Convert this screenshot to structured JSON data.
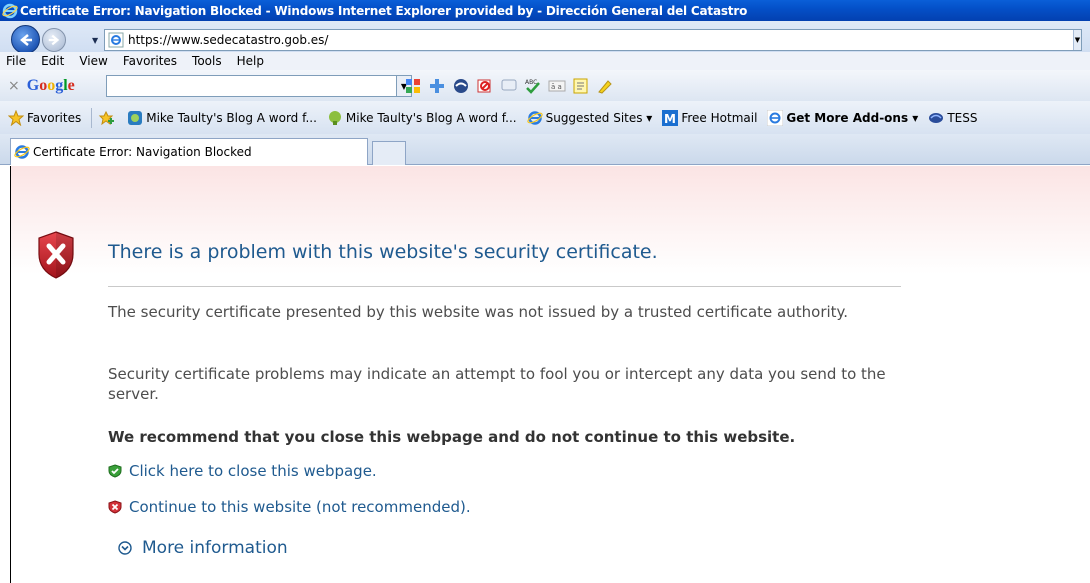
{
  "window": {
    "title": "Certificate Error: Navigation Blocked - Windows Internet Explorer provided by  - Dirección General del Catastro"
  },
  "address_bar": {
    "url": "https://www.sedecatastro.gob.es/"
  },
  "menu": {
    "items": [
      "File",
      "Edit",
      "View",
      "Favorites",
      "Tools",
      "Help"
    ]
  },
  "google_toolbar": {
    "logo": "Google",
    "close_glyph": "×",
    "search_value": ""
  },
  "favorites_bar": {
    "favorites_label": "Favorites",
    "items": [
      {
        "label": "Mike Taulty's Blog  A word f...",
        "icon": "blog-icon"
      },
      {
        "label": "Mike Taulty's Blog  A word f...",
        "icon": "blog-icon"
      },
      {
        "label": "Suggested Sites ▾",
        "icon": "ie-icon"
      },
      {
        "label": "Free Hotmail",
        "icon": "hotmail-icon"
      },
      {
        "label": "Get More Add-ons ▾",
        "icon": "ie-icon"
      },
      {
        "label": "TESS",
        "icon": "tess-icon"
      }
    ]
  },
  "tab": {
    "label": "Certificate Error: Navigation Blocked"
  },
  "page": {
    "headline": "There is a problem with this website's security certificate.",
    "paragraph1": "The security certificate presented by this website was not issued by a trusted certificate authority.",
    "paragraph2": "Security certificate problems may indicate an attempt to fool you or intercept any data you send to the server.",
    "recommendation": "We recommend that you close this webpage and do not continue to this website.",
    "close_link": "Click here to close this webpage.",
    "continue_link": "Continue to this website (not recommended).",
    "more_info": "More information"
  },
  "colors": {
    "title_bar": "#0450c8",
    "link": "#1f5a8f",
    "shield": "#c4262e"
  }
}
